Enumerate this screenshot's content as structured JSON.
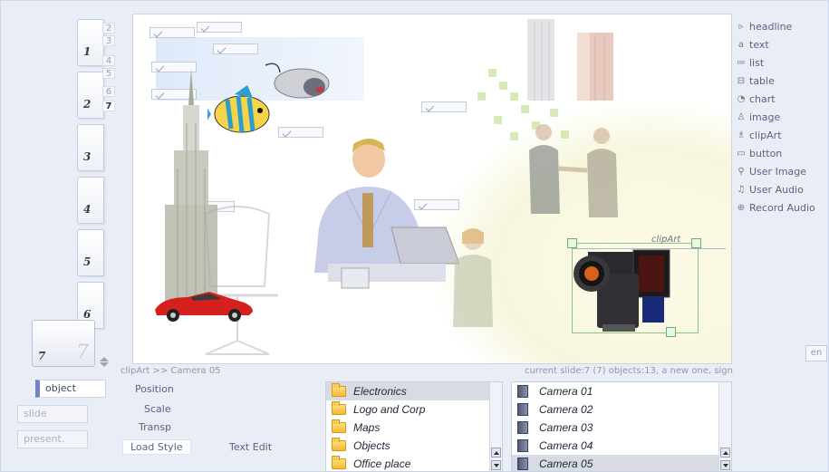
{
  "slides": {
    "thumbs": [
      "1",
      "2",
      "3",
      "4",
      "5",
      "6"
    ],
    "subnums": [
      "2",
      "3",
      "4",
      "5",
      "6",
      "7"
    ],
    "current": "7",
    "current_ghost": "7"
  },
  "canvas": {
    "selection_label": "clipArt"
  },
  "status": {
    "path": "clipArt >> Camera 05",
    "info": "current slide:7 (7) objects:13, a new one, sign"
  },
  "tools": [
    {
      "icon": "headline-icon",
      "glyph": "▹",
      "label": "headline"
    },
    {
      "icon": "text-icon",
      "glyph": "a",
      "label": "text"
    },
    {
      "icon": "list-icon",
      "glyph": "≔",
      "label": "list"
    },
    {
      "icon": "table-icon",
      "glyph": "⊟",
      "label": "table"
    },
    {
      "icon": "chart-icon",
      "glyph": "◔",
      "label": "chart"
    },
    {
      "icon": "image-icon",
      "glyph": "♙",
      "label": "image"
    },
    {
      "icon": "clipart-icon",
      "glyph": "♗",
      "label": "clipArt"
    },
    {
      "icon": "button-icon",
      "glyph": "▭",
      "label": "button"
    },
    {
      "icon": "user-image-icon",
      "glyph": "⚲",
      "label": "User Image"
    },
    {
      "icon": "user-audio-icon",
      "glyph": "♫",
      "label": "User Audio"
    },
    {
      "icon": "record-audio-icon",
      "glyph": "⊕",
      "label": "Record Audio"
    }
  ],
  "lang_button": "en",
  "modes": {
    "object": "object",
    "slide": "slide",
    "present": "present."
  },
  "props": {
    "position": "Position",
    "scale": "Scale",
    "transp": "Transp",
    "load_style": "Load Style",
    "text_edit": "Text Edit"
  },
  "categories": [
    "Electronics",
    "Logo and Corp",
    "Maps",
    "Objects",
    "Office place"
  ],
  "selected_category": "Electronics",
  "items": [
    "Camera 01",
    "Camera 02",
    "Camera 03",
    "Camera 04",
    "Camera 05"
  ],
  "selected_item": "Camera 05",
  "colors": {
    "accent": "#6f84c4",
    "selection_green": "#8fc38a",
    "list_selection": "#d8dbe3",
    "folder": "#f3b935"
  }
}
